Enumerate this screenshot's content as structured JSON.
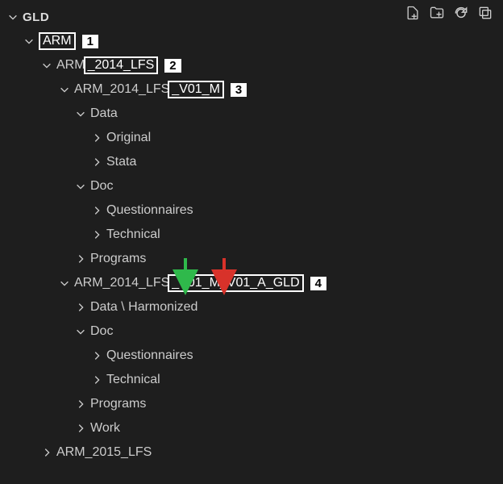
{
  "root": "GLD",
  "toolbar": {
    "icons": [
      "new-file-icon",
      "new-folder-icon",
      "refresh-icon",
      "collapse-all-icon"
    ]
  },
  "callouts": {
    "c1": "1",
    "c2": "2",
    "c3": "3",
    "c4": "4"
  },
  "tree": {
    "arm": "ARM",
    "arm_2014_prefix": "ARM",
    "arm_2014_box": "_2014_LFS",
    "arm_v01m_prefix": "ARM_2014_LFS",
    "arm_v01m_box": "_V01_M",
    "data": "Data",
    "original": "Original",
    "stata": "Stata",
    "doc": "Doc",
    "questionnaires": "Questionnaires",
    "technical": "Technical",
    "programs": "Programs",
    "arm_v01a_prefix": "ARM_2014_LFS",
    "arm_v01a_box": "_V01_M_V01_A_GLD",
    "data_harm": "Data \\ Harmonized",
    "doc2": "Doc",
    "questionnaires2": "Questionnaires",
    "technical2": "Technical",
    "programs2": "Programs",
    "work": "Work",
    "arm_2015": "ARM_2015_LFS"
  }
}
